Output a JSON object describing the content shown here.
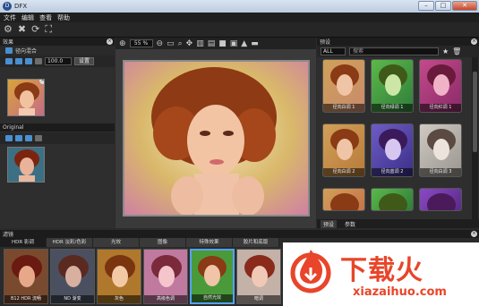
{
  "window": {
    "title": "DFX",
    "app_icon_text": "D"
  },
  "menu": [
    "文件",
    "编辑",
    "查看",
    "帮助"
  ],
  "toolbar": {
    "icons": [
      "gear-icon",
      "close-icon",
      "refresh-icon",
      "crop-icon"
    ]
  },
  "left_panel": {
    "title": "效果",
    "effect_name": "径向混合",
    "amount_value": "100.0",
    "confirm_label": "设置",
    "original_title": "Original"
  },
  "center": {
    "zoom_value": "55 %"
  },
  "right_panel": {
    "title": "预设",
    "filter_value": "ALL",
    "search_placeholder": "搜索",
    "presets": [
      "径向白调 1",
      "径向绿调 1",
      "径向红调 1",
      "径向白调 2",
      "径向蓝调 2",
      "径向白调 3",
      "",
      "",
      ""
    ],
    "tabs": [
      "预设",
      "参数"
    ]
  },
  "bottom_panel": {
    "title": "滤镜",
    "categories": [
      "HDR 影调",
      "HDR 淡彩/色彩",
      "光效",
      "图像",
      "特殊效果",
      "胶片和底版"
    ],
    "effects": [
      "B12 HDR 流畅",
      "ND 渐变",
      "灰色",
      "高级色调",
      "自然光效",
      "暗调"
    ]
  },
  "watermark": {
    "cn": "下载火",
    "en": "xiazaihuo.com"
  },
  "colors": {
    "accent": "#54a2ff",
    "brand_red": "#e8452a"
  }
}
